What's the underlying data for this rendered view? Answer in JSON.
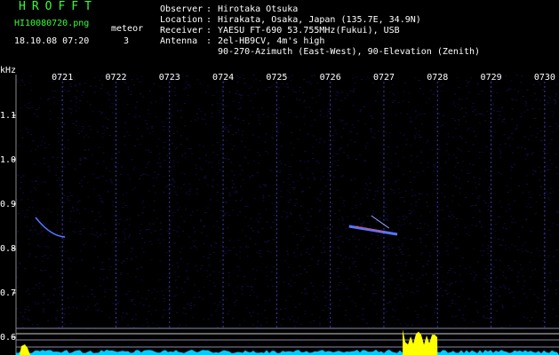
{
  "header": {
    "app_name": "HROFFT",
    "filename": "HI10080720.png",
    "datetime": "18.10.08 07:20",
    "meteor_label": "meteor",
    "meteor_count": "3"
  },
  "info": [
    {
      "label": "Observer",
      "value": "Hirotaka Otsuka"
    },
    {
      "label": "Location",
      "value": "Hirakata, Osaka, Japan (135.7E, 34.9N)"
    },
    {
      "label": "Receiver",
      "value": "YAESU FT-690 53.755MHz(Fukui), USB"
    },
    {
      "label": "Antenna",
      "value": "2el-HB9CV, 4m's high"
    },
    {
      "label": "",
      "value": "90-270-Azimuth (East-West), 90-Elevation (Zenith)"
    }
  ],
  "info_separator": ":",
  "colors": {
    "background": "#000000",
    "grid": "#3a3aaa",
    "text": "#ffffff",
    "title_green": "#33ff33",
    "echo": "#5577ff",
    "echo_red": "#ff4444",
    "power_yellow": "#ffff00",
    "power_cyan": "#00ccff"
  },
  "chart_data": {
    "type": "heatmap",
    "ylabel": "kHz",
    "x_ticks": [
      "0721",
      "0722",
      "0723",
      "0724",
      "0725",
      "0726",
      "0727",
      "0728",
      "0729",
      "0730"
    ],
    "y_ticks": [
      "1.1",
      "1.0",
      "0.9",
      "0.8",
      "0.7",
      "0.6"
    ],
    "y_range": [
      0.6,
      1.1
    ],
    "x_range_minutes": [
      0,
      10
    ],
    "echoes": [
      {
        "start_min": 0.0,
        "end_min": 0.55,
        "freq_start_khz": 0.87,
        "freq_end_khz": 0.83,
        "type": "streak"
      },
      {
        "start_min": 5.85,
        "end_min": 6.75,
        "freq_start_khz": 0.85,
        "freq_end_khz": 0.84,
        "type": "head"
      }
    ],
    "power_bursts": [
      {
        "start_min": 6.85,
        "end_min": 7.5,
        "level": 0.9
      }
    ]
  }
}
